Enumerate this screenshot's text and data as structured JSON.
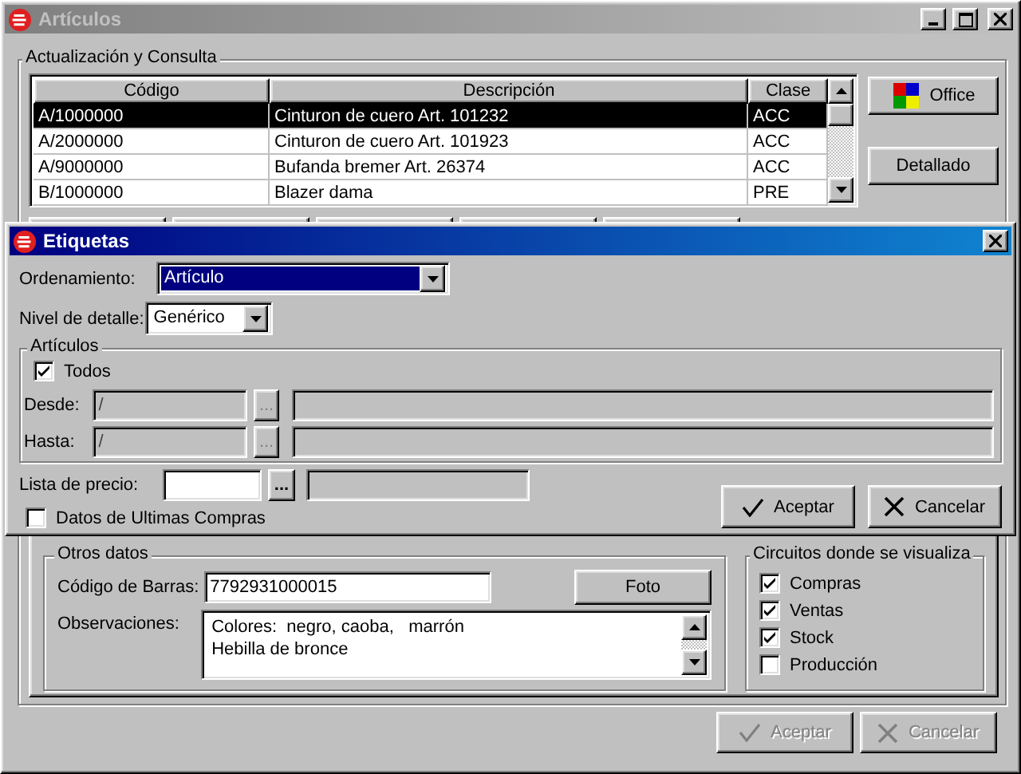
{
  "window": {
    "title": "Artículos",
    "active": false
  },
  "consulta": {
    "title": "Actualización y Consulta",
    "columns": [
      "Código",
      "Descripción",
      "Clase"
    ],
    "rows": [
      {
        "cells": [
          "A/1000000",
          "Cinturon de cuero Art. 101232",
          "ACC"
        ],
        "selected": true
      },
      {
        "cells": [
          "A/2000000",
          "Cinturon de cuero Art. 101923",
          "ACC"
        ],
        "selected": false
      },
      {
        "cells": [
          "A/9000000",
          "Bufanda bremer  Art. 26374",
          "ACC"
        ],
        "selected": false
      },
      {
        "cells": [
          "B/1000000",
          "Blazer dama",
          "PRE"
        ],
        "selected": false
      }
    ]
  },
  "side_buttons": [
    {
      "label": "Office",
      "kind": "office"
    },
    {
      "label": "Detallado",
      "kind": "plain"
    }
  ],
  "otros_datos": {
    "title": "Otros datos",
    "barcode_label": "Código de Barras:",
    "barcode": "7792931000015",
    "photo_button": "Foto",
    "notes_label": "Observaciones:",
    "notes": [
      "Colores:  negro, caoba,   marrón",
      "Hebilla de bronce"
    ]
  },
  "circuitos": {
    "title": "Circuitos donde se visualiza",
    "items": [
      {
        "label": "Compras",
        "checked": true
      },
      {
        "label": "Ventas",
        "checked": true
      },
      {
        "label": "Stock",
        "checked": true
      },
      {
        "label": "Producción",
        "checked": false
      }
    ]
  },
  "footer_buttons": [
    {
      "label": "Aceptar",
      "kind": "accept",
      "disabled": true
    },
    {
      "label": "Cancelar",
      "kind": "cancel",
      "disabled": true
    }
  ],
  "dialog": {
    "title": "Etiquetas",
    "active": true,
    "ordenamiento": {
      "label": "Ordenamiento:",
      "value": "Artículo",
      "focused": true
    },
    "nivel": {
      "label": "Nivel de detalle:",
      "value": "Genérico",
      "focused": false
    },
    "articulos": {
      "title": "Artículos",
      "todos": {
        "label": "Todos",
        "checked": true
      },
      "ranges": [
        {
          "label": "Desde:",
          "value": "/",
          "browse": "...",
          "disabled": true
        },
        {
          "label": "Hasta:",
          "value": "/",
          "browse": "...",
          "disabled": true
        }
      ]
    },
    "lista_precio": {
      "label": "Lista de precio:",
      "browse": "...",
      "disabled": false
    },
    "ultimas_compras": {
      "label": "Datos de Ultimas Compras",
      "checked": false
    },
    "buttons": [
      {
        "label": "Aceptar",
        "kind": "accept",
        "disabled": false
      },
      {
        "label": "Cancelar",
        "kind": "cancel",
        "disabled": false
      }
    ]
  }
}
